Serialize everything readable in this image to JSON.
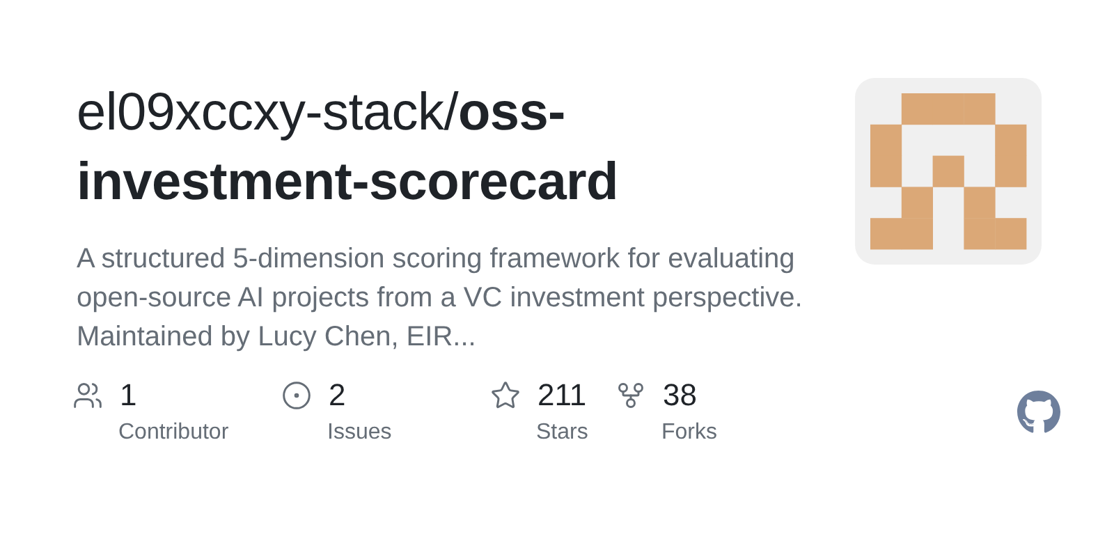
{
  "repo": {
    "title": "el09xccxy-stack/**oss-investment-scorecard**",
    "description": "A structured 5-dimension scoring framework for evaluating open-source AI projects from a VC investment perspective. Maintained by Lucy Chen, EIR..."
  },
  "stats": [
    {
      "kind": "contributors",
      "value": "1",
      "label": "Contributor"
    },
    {
      "kind": "issues",
      "value": "2",
      "label": "Issues"
    },
    {
      "kind": "stars",
      "value": "211",
      "label": "Stars"
    },
    {
      "kind": "forks",
      "value": "38",
      "label": "Forks"
    }
  ]
}
